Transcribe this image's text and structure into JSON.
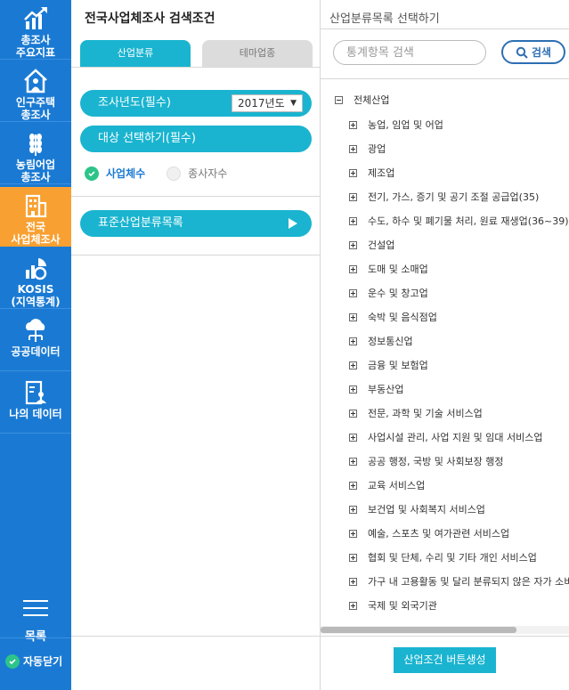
{
  "sidebar": {
    "items": [
      {
        "label_1": "총조사",
        "label_2": "주요지표",
        "icon": "chart-up-icon"
      },
      {
        "label_1": "인구주택",
        "label_2": "총조사",
        "icon": "house-person-icon"
      },
      {
        "label_1": "농림어업",
        "label_2": "총조사",
        "icon": "wheat-icon"
      },
      {
        "label_1": "전국",
        "label_2": "사업체조사",
        "icon": "building-icon"
      },
      {
        "label_1": "KOSIS",
        "label_2": "(지역통계)",
        "icon": "pie-bar-icon"
      },
      {
        "label_1": "공공데이터",
        "label_2": "",
        "icon": "cloud-tree-icon"
      },
      {
        "label_1": "나의 데이터",
        "label_2": "",
        "icon": "document-person-icon"
      }
    ],
    "active_index": 3,
    "menu_label": "목록",
    "autoclose_label": "자동닫기"
  },
  "mid": {
    "title": "전국사업체조사 검색조건",
    "tabs": [
      "산업분류",
      "테마업종"
    ],
    "year_label": "조사년도(필수)",
    "year_value": "2017년도",
    "target_label": "대상 선택하기(필수)",
    "radio_options": [
      "사업체수",
      "종사자수"
    ],
    "radio_selected": 0,
    "classification_label": "표준산업분류목록"
  },
  "right": {
    "title": "산업분류목록 선택하기",
    "search_placeholder": "통계항목 검색",
    "search_button": "검색",
    "root_label": "전체산업",
    "items": [
      "농업, 임업 및 어업",
      "광업",
      "제조업",
      "전기, 가스, 증기 및 공기 조절 공급업(35)",
      "수도, 하수 및 폐기물 처리, 원료 재생업(36~39)",
      "건설업",
      "도매 및 소매업",
      "운수 및 창고업",
      "숙박 및 음식점업",
      "정보통신업",
      "금융 및 보험업",
      "부동산업",
      "전문, 과학 및 기술 서비스업",
      "사업시설 관리, 사업 지원 및 임대 서비스업",
      "공공 행정, 국방 및 사회보장 행정",
      "교육 서비스업",
      "보건업 및 사회복지 서비스업",
      "예술, 스포츠 및 여가관련 서비스업",
      "협회 및 단체, 수리 및 기타 개인 서비스업",
      "가구 내 고용활동 및 달리 분류되지 않은 자가 소비",
      "국제 및 외국기관"
    ],
    "generate_button": "산업조건 버튼생성"
  },
  "colors": {
    "sidebar_bg": "#1a7ad3",
    "sidebar_active": "#f8a032",
    "accent": "#1ab4d0",
    "check_green": "#2dc48a"
  }
}
